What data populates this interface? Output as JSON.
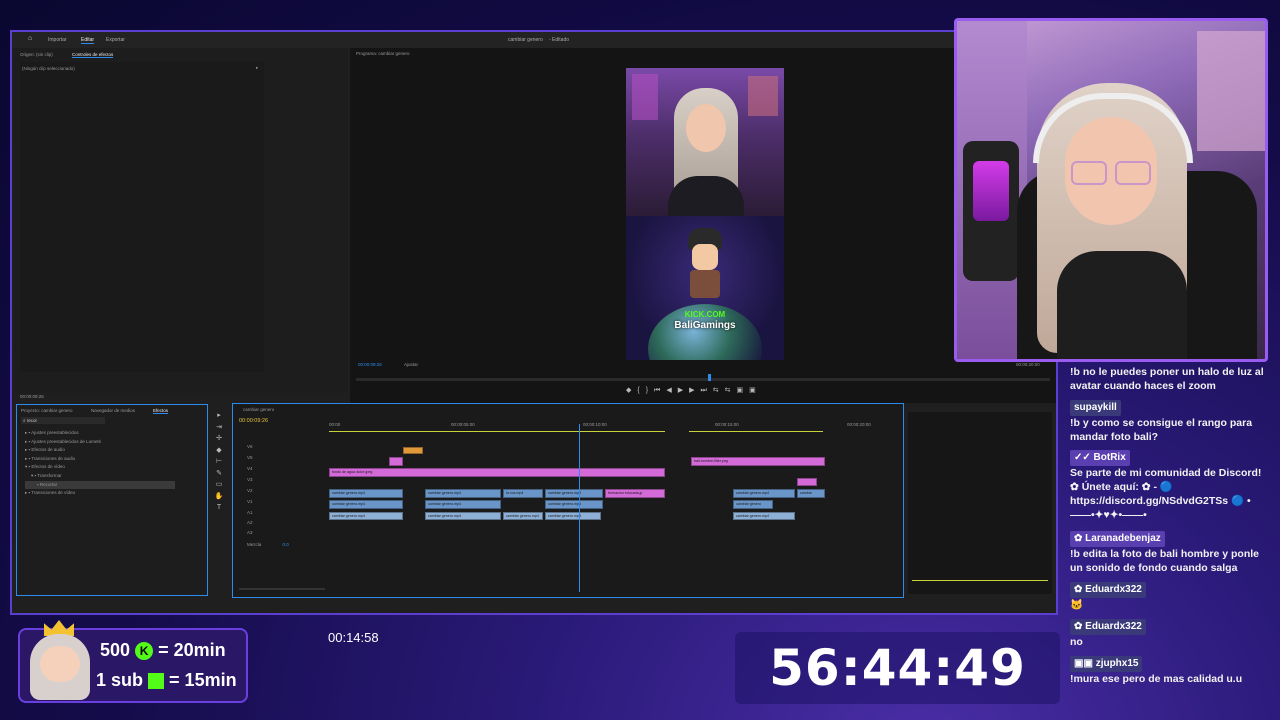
{
  "editor": {
    "tabs": [
      "Importar",
      "Editar",
      "Exportar"
    ],
    "window_title": "cambiar genero",
    "window_suffix": "- Editado",
    "source_tab": "Origen: (sin clip)",
    "effect_controls_tab": "Controles de efectos",
    "no_clip": "(Ningún clip seleccionado)",
    "program_label": "Programa: cambiar genero",
    "program_time": "00:00:09:26",
    "fit_label": "Ajustar",
    "program_end_time": "00:00:20:00",
    "left_time": "00:00:09:26"
  },
  "project": {
    "tabs": [
      "Proyecto: cambiar genero",
      "Navegador de medios",
      "Efectos"
    ],
    "search_value": "recor",
    "tree": [
      "Ajustes preestablecidos",
      "Ajustes preestablecidos de Lumetri",
      "Efectos de audio",
      "Transiciones de audio",
      "Efectos de vídeo",
      "Transformar",
      "Recortar",
      "Transiciones de vídeo"
    ]
  },
  "timeline": {
    "tab": "cambiar genero",
    "timecode": "00:00:09:26",
    "ruler": [
      "00:00",
      "00:00:05:00",
      "00:00:10:00",
      "00:00:15:00",
      "00:00:20:00"
    ],
    "tracks": [
      "V6",
      "V5",
      "V4",
      "V3",
      "V2",
      "V1",
      "A1",
      "A2",
      "A3"
    ],
    "mix_label": "Mezcla",
    "mix_value": "0.0",
    "clips": {
      "fondo": "fondo de agua dulce.jpeg",
      "bali": "bali-hombre-filter.png",
      "v2a": "cambiar genero.mp4",
      "v2b": "cambiar genero.mp4",
      "v2c": "la voz.mp4",
      "v2d": "cambiar genero.mp4",
      "v2e": "formacion educada.jp",
      "v1a": "cambiar genero.mp4",
      "v1b": "cambiar genero.mp4",
      "v1c": "cambiar genero.mp4",
      "v1d": "cambiar genero",
      "v2f": "cambiar genero.mp4",
      "v2g": "cambia",
      "a1": "cambiar genero.mp4",
      "a2": "cambiar genero.mp4",
      "a3": "cambiar genero.mp4",
      "a4": "cambiar genero.mp4",
      "a5": "cambiar genero.mp4"
    }
  },
  "video": {
    "kick_label": "KICK.COM",
    "channel": "BaliGamings"
  },
  "chat": [
    {
      "user": "",
      "text": "!b no le puedes poner un halo de luz al avatar cuando haces el zoom"
    },
    {
      "user": "supaykill",
      "user_color": "#3a3a7a",
      "text": "!b y como se consigue el rango para mandar foto bali?"
    },
    {
      "user": "BotRix",
      "user_color": "#5a3fb0",
      "text": "Se parte de mi comunidad de Discord! ✿ Únete aquí: ✿ - 🔵 https://discord.gg/NSdvdG2TSs 🔵 •——•✦♥✦•——•"
    },
    {
      "user": "Laranadebenjaz",
      "user_color": "#5a3fb0",
      "text": "!b edita la foto de bali hombre y ponle un sonido de fondo cuando salga"
    },
    {
      "user": "Eduardx322",
      "user_color": "#3a3a7a",
      "text": "🐱"
    },
    {
      "user": "Eduardx322",
      "user_color": "#3a3a7a",
      "text": "no"
    },
    {
      "user": "zjuphx15",
      "user_color": "#3a3a7a",
      "text": "!mura ese pero de mas calidad u.u"
    }
  ],
  "overlay": {
    "line1_amount": "500",
    "line1_rate": "= 20min",
    "line2_amount": "1 sub",
    "line2_rate": "= 15min",
    "clock": "00:14:58",
    "countdown": "56:44:49"
  },
  "colors": {
    "accent": "#5a3fd0",
    "timeline_pink": "#d46ad8",
    "timeline_blue": "#6a95c8",
    "playhead": "#2d8ceb",
    "kick_green": "#53fc18"
  }
}
